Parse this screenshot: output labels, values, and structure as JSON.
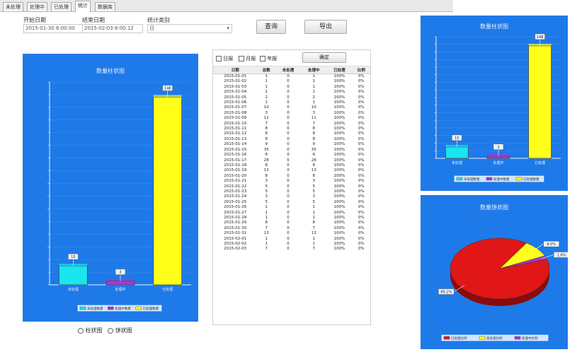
{
  "tabs": [
    "未处理",
    "处理中",
    "已处理",
    "统计",
    "数据库"
  ],
  "filters": {
    "start_label": "开始日期",
    "start_value": "2015-01-30  8:00:00",
    "end_label": "结束日期",
    "end_value": "2015-02-03  8:00:12",
    "type_label": "统计类别",
    "type_value": "日"
  },
  "buttons": {
    "query": "查询",
    "export": "导出",
    "grid_confirm": "确定"
  },
  "grid": {
    "options": [
      "日报",
      "月报",
      "年报"
    ],
    "columns": [
      "日期",
      "总数",
      "未处理",
      "处理中",
      "已处理",
      "比例"
    ],
    "rows": [
      [
        "2015-01-01",
        "1",
        "0",
        "1",
        "100%",
        "0%"
      ],
      [
        "2015-01-02",
        "1",
        "0",
        "1",
        "100%",
        "0%"
      ],
      [
        "2015-01-03",
        "1",
        "0",
        "1",
        "100%",
        "0%"
      ],
      [
        "2015-01-04",
        "1",
        "0",
        "1",
        "100%",
        "0%"
      ],
      [
        "2015-01-05",
        "2",
        "0",
        "2",
        "100%",
        "0%"
      ],
      [
        "2015-01-06",
        "1",
        "0",
        "1",
        "100%",
        "0%"
      ],
      [
        "2015-01-07",
        "10",
        "0",
        "10",
        "100%",
        "0%"
      ],
      [
        "2015-01-08",
        "3",
        "0",
        "3",
        "100%",
        "0%"
      ],
      [
        "2015-01-09",
        "11",
        "0",
        "11",
        "100%",
        "0%"
      ],
      [
        "2015-01-10",
        "7",
        "0",
        "7",
        "100%",
        "0%"
      ],
      [
        "2015-01-11",
        "8",
        "0",
        "8",
        "100%",
        "0%"
      ],
      [
        "2015-01-12",
        "8",
        "0",
        "8",
        "100%",
        "0%"
      ],
      [
        "2015-01-13",
        "8",
        "0",
        "8",
        "100%",
        "0%"
      ],
      [
        "2015-01-14",
        "9",
        "0",
        "9",
        "100%",
        "0%"
      ],
      [
        "2015-01-15",
        "35",
        "0",
        "35",
        "100%",
        "0%"
      ],
      [
        "2015-01-16",
        "6",
        "0",
        "6",
        "100%",
        "0%"
      ],
      [
        "2015-01-17",
        "28",
        "0",
        "28",
        "100%",
        "0%"
      ],
      [
        "2015-01-18",
        "8",
        "0",
        "8",
        "100%",
        "0%"
      ],
      [
        "2015-01-19",
        "13",
        "0",
        "13",
        "100%",
        "0%"
      ],
      [
        "2015-01-20",
        "8",
        "0",
        "8",
        "100%",
        "0%"
      ],
      [
        "2015-01-21",
        "3",
        "0",
        "3",
        "100%",
        "0%"
      ],
      [
        "2015-01-22",
        "5",
        "0",
        "5",
        "100%",
        "0%"
      ],
      [
        "2015-01-23",
        "5",
        "0",
        "5",
        "100%",
        "0%"
      ],
      [
        "2015-01-24",
        "3",
        "0",
        "3",
        "100%",
        "0%"
      ],
      [
        "2015-01-25",
        "5",
        "0",
        "5",
        "100%",
        "0%"
      ],
      [
        "2015-01-26",
        "1",
        "0",
        "1",
        "100%",
        "0%"
      ],
      [
        "2015-01-27",
        "1",
        "0",
        "1",
        "100%",
        "0%"
      ],
      [
        "2015-01-28",
        "1",
        "0",
        "1",
        "100%",
        "0%"
      ],
      [
        "2015-01-29",
        "8",
        "0",
        "8",
        "100%",
        "0%"
      ],
      [
        "2015-01-30",
        "7",
        "0",
        "7",
        "100%",
        "0%"
      ],
      [
        "2015-01-31",
        "13",
        "0",
        "13",
        "100%",
        "0%"
      ],
      [
        "2015-02-01",
        "1",
        "0",
        "1",
        "100%",
        "0%"
      ],
      [
        "2015-02-02",
        "1",
        "0",
        "1",
        "100%",
        "0%"
      ],
      [
        "2015-02-03",
        "7",
        "0",
        "7",
        "100%",
        "0%"
      ]
    ]
  },
  "view_options": {
    "bar": "柱状图",
    "pie": "饼状图"
  },
  "colors": {
    "panel": "#1e7ae8",
    "cyan": "#19e6ef",
    "purple": "#a23ad9",
    "yellow": "#ffff1a",
    "red": "#e11616"
  },
  "chart_data": [
    {
      "type": "bar",
      "title": "数量柱状图",
      "categories": [
        "未处理",
        "处理中",
        "已处理"
      ],
      "values": [
        15,
        3,
        148
      ],
      "data_labels": [
        "15",
        "3",
        "148"
      ],
      "colors": [
        "#19e6ef",
        "#a23ad9",
        "#ffff1a"
      ],
      "legend": [
        "未处理数量",
        "处理中数量",
        "已处理数量"
      ],
      "legend_position": "bottom",
      "ylim": [
        0,
        160
      ],
      "grid": true
    },
    {
      "type": "bar",
      "title": "数量柱状图",
      "categories": [
        "未处理",
        "处理中",
        "已处理"
      ],
      "values": [
        15,
        3,
        148
      ],
      "data_labels": [
        "15",
        "3",
        "148"
      ],
      "colors": [
        "#19e6ef",
        "#a23ad9",
        "#ffff1a"
      ],
      "legend": [
        "未处理数量",
        "处理中数量",
        "已处理数量"
      ],
      "legend_position": "bottom",
      "ylim": [
        0,
        160
      ],
      "grid": true
    },
    {
      "type": "pie",
      "title": "数量饼状图",
      "categories": [
        "已处理",
        "未处理",
        "处理中"
      ],
      "values": [
        148,
        15,
        3
      ],
      "data_labels": [
        "89.2%",
        "9.0%",
        "1.8%"
      ],
      "colors": [
        "#e11616",
        "#ffff1a",
        "#a23ad9"
      ],
      "legend": [
        "已处理比例",
        "未处理比例",
        "处理中比例"
      ],
      "legend_position": "bottom"
    }
  ]
}
